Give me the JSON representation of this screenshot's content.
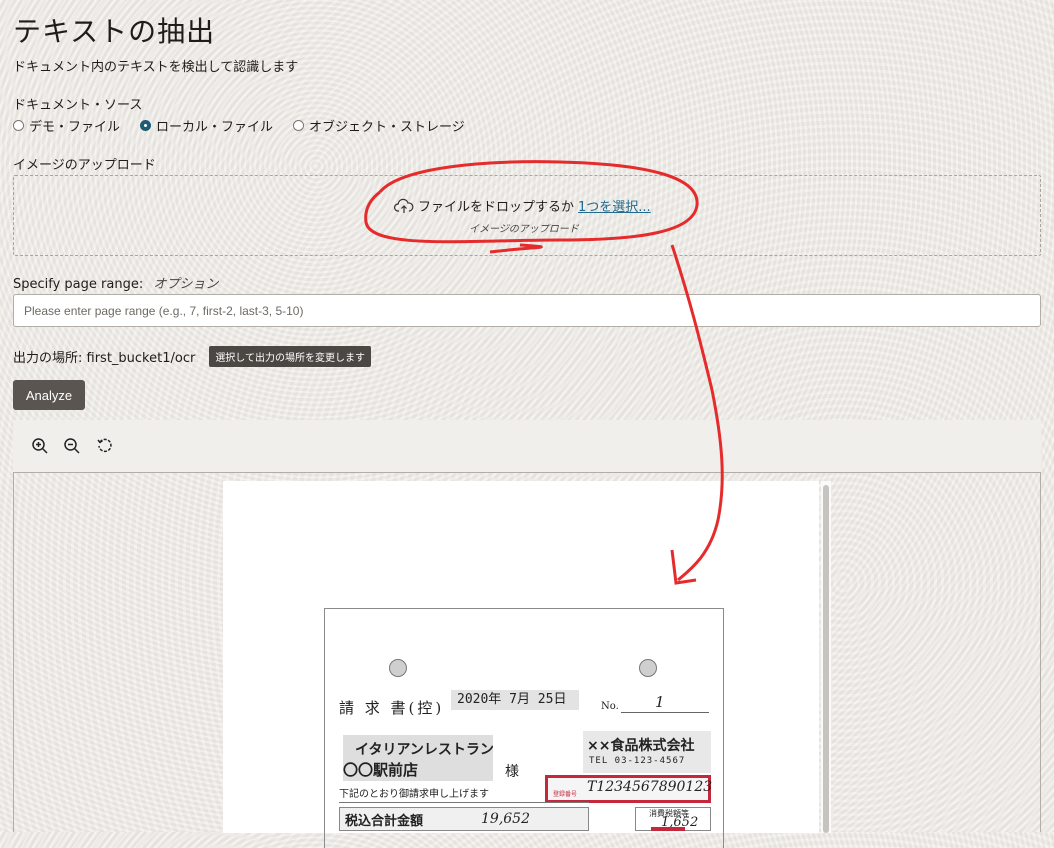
{
  "page": {
    "title": "テキストの抽出",
    "subtitle": "ドキュメント内のテキストを検出して認識します"
  },
  "source": {
    "label": "ドキュメント・ソース",
    "options": [
      {
        "label": "デモ・ファイル",
        "selected": false
      },
      {
        "label": "ローカル・ファイル",
        "selected": true
      },
      {
        "label": "オブジェクト・ストレージ",
        "selected": false
      }
    ]
  },
  "upload": {
    "label": "イメージのアップロード",
    "drop_text": "ファイルをドロップするか",
    "select_link": "1つを選択...",
    "sub_label": "イメージのアップロード",
    "icon": "cloud-upload-icon"
  },
  "page_range": {
    "label": "Specify page range:",
    "optional": "オプション",
    "placeholder": "Please enter page range (e.g., 7, first-2, last-3, 5-10)",
    "value": ""
  },
  "output": {
    "label": "出力の場所: first_bucket1/ocr",
    "change_tag": "選択して出力の場所を変更します"
  },
  "actions": {
    "analyze_label": "Analyze"
  },
  "viewer": {
    "tools": [
      {
        "name": "zoom-in-icon"
      },
      {
        "name": "zoom-out-icon"
      },
      {
        "name": "reset-icon"
      }
    ]
  },
  "document": {
    "title": "請 求 書(控)",
    "date": "2020年 7月 25日",
    "no_label": "No.",
    "no_value": "1",
    "customer_line1": "イタリアンレストラン",
    "customer_line2": "〇〇駅前店",
    "honorific": "様",
    "vendor_name": "××食品株式会社",
    "vendor_tel": "TEL 03-123-4567",
    "registration_label": "登録番号",
    "registration_number": "T1234567890123",
    "message": "下記のとおり御請求申し上げます",
    "total_label": "税込合計金額",
    "total_value": "19,652",
    "tax_label": "消費税額等",
    "tax_value": "1,652"
  },
  "colors": {
    "accent": "#1e5b74",
    "annotation": "#e52b2b",
    "button_bg": "#5a5550",
    "link": "#1f6a8e"
  }
}
